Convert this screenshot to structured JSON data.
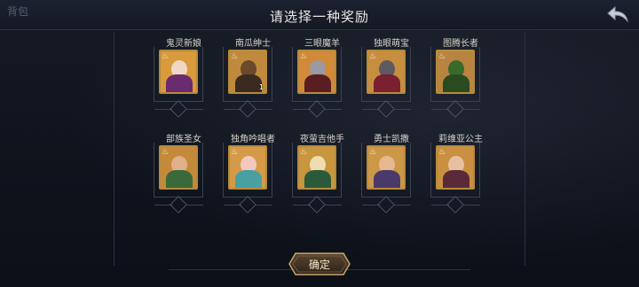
{
  "header": {
    "backpack_label": "背包",
    "title": "请选择一种奖励"
  },
  "rewards": [
    {
      "name": "鬼灵新娘",
      "count": "",
      "bg": "#d89a3a",
      "face": "#f0d6c4",
      "body": "#6a2a6e"
    },
    {
      "name": "南瓜绅士",
      "count": "1",
      "bg": "#c08a3e",
      "face": "#6b4a2a",
      "body": "#3a2a20"
    },
    {
      "name": "三眼魔羊",
      "count": "",
      "bg": "#d08a3a",
      "face": "#9a9aa2",
      "body": "#5a1e22"
    },
    {
      "name": "独眼萌宝",
      "count": "",
      "bg": "#c88e40",
      "face": "#5e5a60",
      "body": "#7a2030"
    },
    {
      "name": "图腾长者",
      "count": "",
      "bg": "#b88440",
      "face": "#3a6a2a",
      "body": "#2a4a20"
    },
    {
      "name": "部族圣女",
      "count": "",
      "bg": "#c48a3a",
      "face": "#e0b08c",
      "body": "#3a6a3a"
    },
    {
      "name": "独角吟唱者",
      "count": "",
      "bg": "#d49a48",
      "face": "#f2c8c0",
      "body": "#4aa0a0"
    },
    {
      "name": "夜萤吉他手",
      "count": "",
      "bg": "#c8963e",
      "face": "#f0dcb0",
      "body": "#2a5a3a"
    },
    {
      "name": "勇士凯撒",
      "count": "",
      "bg": "#cc9848",
      "face": "#e8b890",
      "body": "#4a3a6a"
    },
    {
      "name": "莉维亚公主",
      "count": "",
      "bg": "#c89040",
      "face": "#e8c0a0",
      "body": "#5a2a3a"
    }
  ],
  "footer": {
    "confirm_label": "确定"
  },
  "colors": {
    "accent_gold": "#b78a3a",
    "title_text": "#e8e6e1"
  }
}
